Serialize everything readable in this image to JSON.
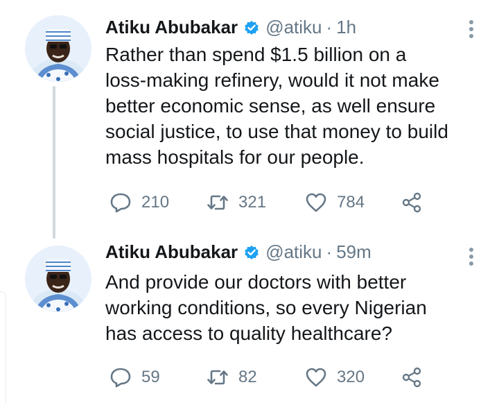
{
  "tweets": [
    {
      "author_name": "Atiku Abubakar",
      "handle": "@atiku",
      "separator": "·",
      "time": "1h",
      "text": "Rather than spend $1.5 billion on a\nloss-making refinery, would it not make\nbetter economic sense, as well ensure\nsocial justice, to use that money to build\nmass hospitals for our people.",
      "replies": "210",
      "retweets": "321",
      "likes": "784"
    },
    {
      "author_name": "Atiku Abubakar",
      "handle": "@atiku",
      "separator": "·",
      "time": "59m",
      "text": "And provide our doctors with better\nworking conditions, so every Nigerian\nhas access to quality healthcare?",
      "replies": "59",
      "retweets": "82",
      "likes": "320"
    }
  ],
  "colors": {
    "verified_badge": "#1da1f2",
    "secondary_text": "#657786",
    "primary_text": "#14171a",
    "thread_line": "#cfd9de"
  },
  "icons": {
    "reply": "reply-icon",
    "retweet": "retweet-icon",
    "like": "heart-icon",
    "share": "share-icon",
    "verified": "verified-badge-icon",
    "more": "more-options-icon"
  }
}
